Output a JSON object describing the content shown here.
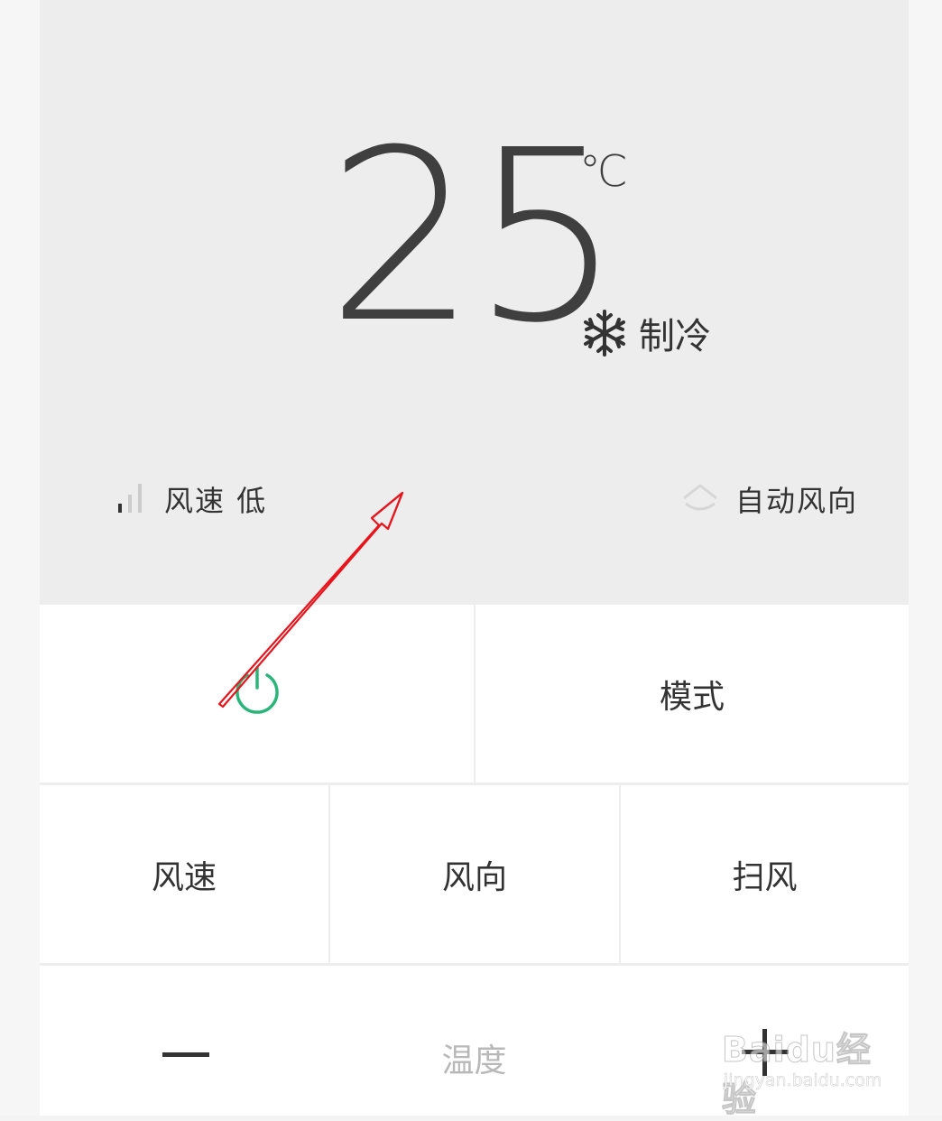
{
  "thermostat": {
    "temperature": "25",
    "unit": "℃",
    "mode_icon": "snowflake-icon",
    "mode_label": "制冷"
  },
  "status": {
    "fan_icon": "signal-bars-icon",
    "fan_label": "风速 低",
    "direction_icon": "auto-direction-icon",
    "direction_label": "自动风向"
  },
  "controls": {
    "power_icon": "power-icon",
    "power_color": "#2bb57a",
    "mode": "模式",
    "fan_speed": "风速",
    "direction": "风向",
    "swing": "扫风",
    "temperature_label": "温度",
    "minus_icon": "minus-icon",
    "plus_icon": "plus-icon"
  },
  "watermark": {
    "logo": "Baidu经验",
    "url": "jingyan.baidu.com"
  },
  "annotation": {
    "color": "#e8141c",
    "icon": "arrow-icon"
  }
}
